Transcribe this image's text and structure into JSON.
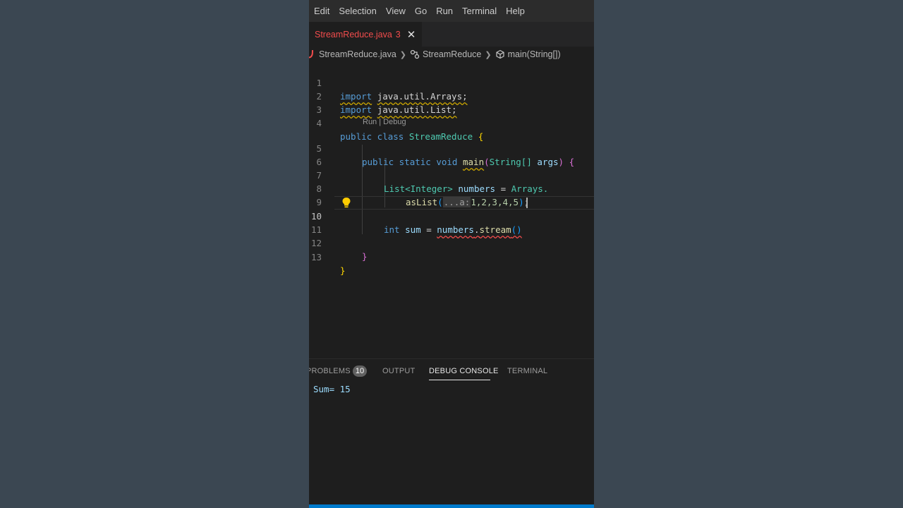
{
  "menu": [
    "Edit",
    "Selection",
    "View",
    "Go",
    "Run",
    "Terminal",
    "Help"
  ],
  "tab": {
    "filename": "StreamReduce.java",
    "problem_count": "3",
    "close_glyph": "✕"
  },
  "breadcrumb": {
    "file": "StreamReduce.java",
    "class": "StreamReduce",
    "method": "main(String[])"
  },
  "codelens": "Run | Debug",
  "line_numbers": [
    "1",
    "2",
    "3",
    "4",
    "5",
    "6",
    "7",
    "8",
    "9",
    "10",
    "11",
    "12",
    "13"
  ],
  "code": {
    "l1": {
      "kw": "import",
      "rest": "java.util.Arrays;"
    },
    "l2": {
      "kw": "import",
      "rest": "java.util.List;"
    },
    "l4": {
      "kw": "public class",
      "name": "StreamReduce",
      "brace": "{"
    },
    "l5": {
      "kw": "public static void",
      "fn": "main",
      "open": "(",
      "type": "String[]",
      "arg": "args",
      "close": ")",
      "brace": "{"
    },
    "l7": {
      "type": "List<Integer>",
      "var": "numbers",
      "eq": "=",
      "cls": "Arrays."
    },
    "l8": {
      "fn": "asList",
      "open": "(",
      "hint": "...a:",
      "nums": "1,2,3,4,5",
      "close": ")",
      "semi": ";"
    },
    "l10": {
      "kw": "int",
      "var": "sum",
      "eq": "=",
      "obj": "numbers",
      "dot": ".",
      "fn": "stream",
      "parens": "()"
    },
    "l12": {
      "brace": "}"
    },
    "l13": {
      "brace": "}"
    }
  },
  "panel": {
    "tabs": {
      "problems": "PROBLEMS",
      "output": "OUTPUT",
      "debug_console": "DEBUG CONSOLE",
      "terminal": "TERMINAL"
    },
    "problems_badge": "10",
    "active_tab": "DEBUG CONSOLE",
    "console_output": "Sum= 15"
  },
  "colors": {
    "accent": "#007acc",
    "error": "#f14c4c",
    "warning": "#cca700"
  }
}
